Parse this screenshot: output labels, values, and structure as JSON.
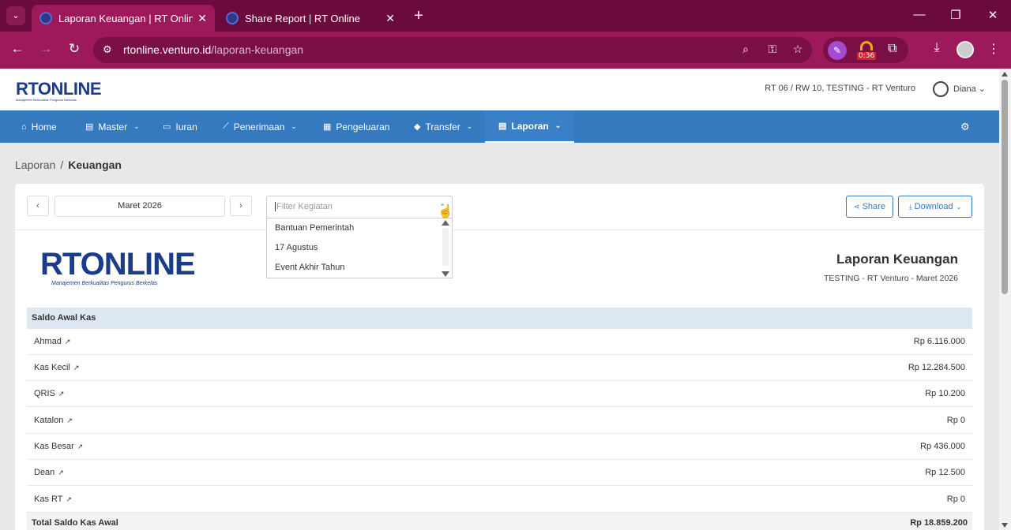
{
  "browser": {
    "tabs": [
      {
        "title": "Laporan Keuangan | RT Online",
        "active": true
      },
      {
        "title": "Share Report | RT Online",
        "active": false
      }
    ],
    "url_host": "rtonline.venturo.id",
    "url_path": "/laporan-keuangan",
    "extension_badge": "0:36"
  },
  "header": {
    "logo": "RTONLINE",
    "logo_tagline": "Manajemen Berkualitas Pengurus Berkelas",
    "rt_info": "RT 06 / RW 10, TESTING - RT Venturo",
    "user_name": "Diana"
  },
  "nav": {
    "items": [
      {
        "label": "Home",
        "icon": "home-icon",
        "dropdown": false
      },
      {
        "label": "Master",
        "icon": "file-icon",
        "dropdown": true
      },
      {
        "label": "Iuran",
        "icon": "card-icon",
        "dropdown": false
      },
      {
        "label": "Penerimaan",
        "icon": "chart-icon",
        "dropdown": true
      },
      {
        "label": "Pengeluaran",
        "icon": "receipt-icon",
        "dropdown": false
      },
      {
        "label": "Transfer",
        "icon": "tag-icon",
        "dropdown": true
      },
      {
        "label": "Laporan",
        "icon": "document-icon",
        "dropdown": true,
        "active": true
      }
    ]
  },
  "breadcrumb": {
    "parent": "Laporan",
    "current": "Keuangan"
  },
  "toolbar": {
    "month": "Maret 2026",
    "filter_placeholder": "Filter Kegiatan",
    "share_label": "Share",
    "download_label": "Download"
  },
  "dropdown_options": [
    "Bantuan Pemerintah",
    "17 Agustus",
    "Event Akhir Tahun"
  ],
  "report": {
    "title": "Laporan Keuangan",
    "subtitle": "TESTING - RT Venturo - Maret 2026",
    "section_title": "Saldo Awal Kas",
    "rows": [
      {
        "name": "Ahmad",
        "value": "Rp 6.116.000"
      },
      {
        "name": "Kas Kecil",
        "value": "Rp 12.284.500"
      },
      {
        "name": "QRIS",
        "value": "Rp 10.200"
      },
      {
        "name": "Katalon",
        "value": "Rp 0"
      },
      {
        "name": "Kas Besar",
        "value": "Rp 436.000"
      },
      {
        "name": "Dean",
        "value": "Rp 12.500"
      },
      {
        "name": "Kas RT",
        "value": "Rp 0"
      }
    ],
    "total_label": "Total Saldo Kas Awal",
    "total_value": "Rp 18.859.200"
  },
  "colors": {
    "chrome": "#9c1a5c",
    "chrome_dark": "#6b0a3c",
    "nav": "#3579be",
    "section_head": "#dde8f3"
  }
}
